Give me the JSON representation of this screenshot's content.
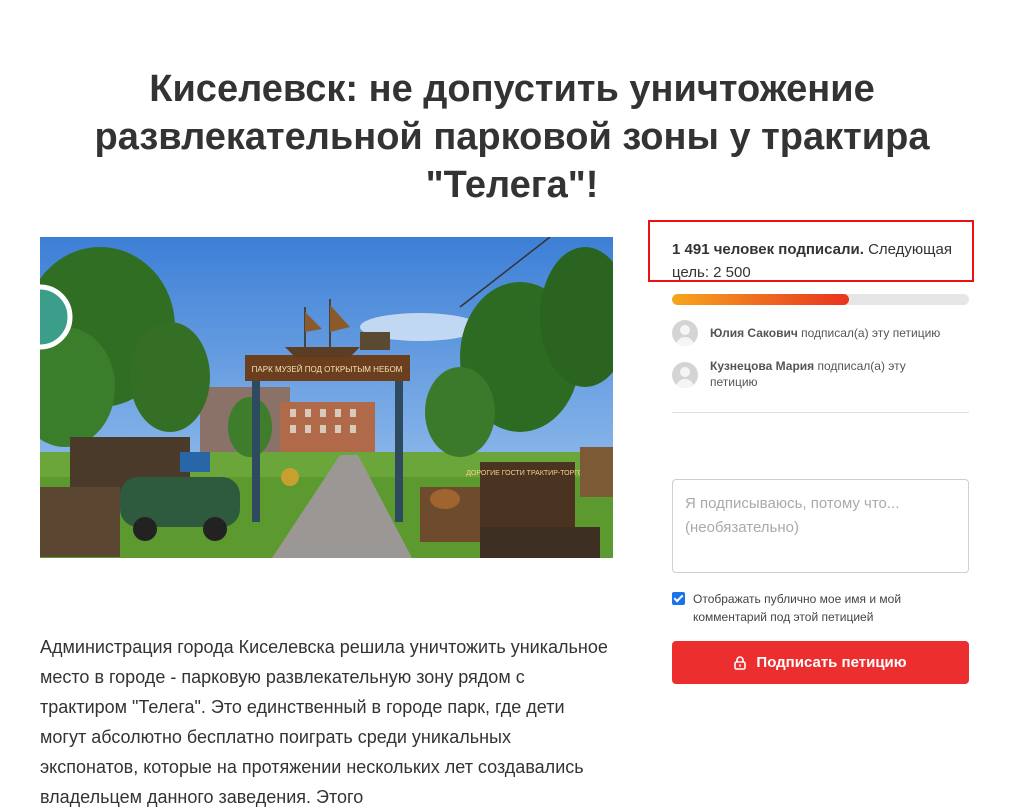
{
  "petition": {
    "title": "Киселевск: не допустить уничтожение развлекательной парковой зоны у трактира \"Телега\"!",
    "image_signs": {
      "arch": "ПАРК МУЗЕЙ ПОД ОТКРЫТЫМ НЕБОМ",
      "board": "ДОРОГИЕ ГОСТИ ТРАКТИР-ТОРГОВ"
    },
    "description": "Администрация города Киселевска решила уничтожить уникальное место в городе - парковую развлекательную зону рядом с трактиром \"Телега\". Это единственный в городе парк, где дети могут абсолютно бесплатно поиграть среди уникальных экспонатов, которые на протяжении нескольких лет создавались владельцем данного заведения. Этого"
  },
  "signatures": {
    "count_bold": "1 491 человек подписали.",
    "next_goal": " Следующая цель: 2 500",
    "signed": 1491,
    "goal": 2500
  },
  "recent_signers": [
    {
      "name": "Юлия Сакович",
      "action": " подписал(а) эту петицию"
    },
    {
      "name": "Кузнецова Мария",
      "action": " подписал(а) эту петицию"
    }
  ],
  "form": {
    "comment_placeholder": "Я подписываюсь, потому что... (необязательно)",
    "public_checkbox_label": "Отображать публично мое имя и мой комментарий под этой петицией",
    "public_checked": true,
    "sign_button_label": "Подписать петицию"
  },
  "colors": {
    "button": "#ec2e2e",
    "highlight_box": "#ee1111",
    "progress_start": "#f7a61c",
    "progress_end": "#e8341f",
    "checkbox": "#1a73e8"
  },
  "icons": [
    "lock-icon",
    "avatar-icon",
    "checkmark-icon"
  ]
}
